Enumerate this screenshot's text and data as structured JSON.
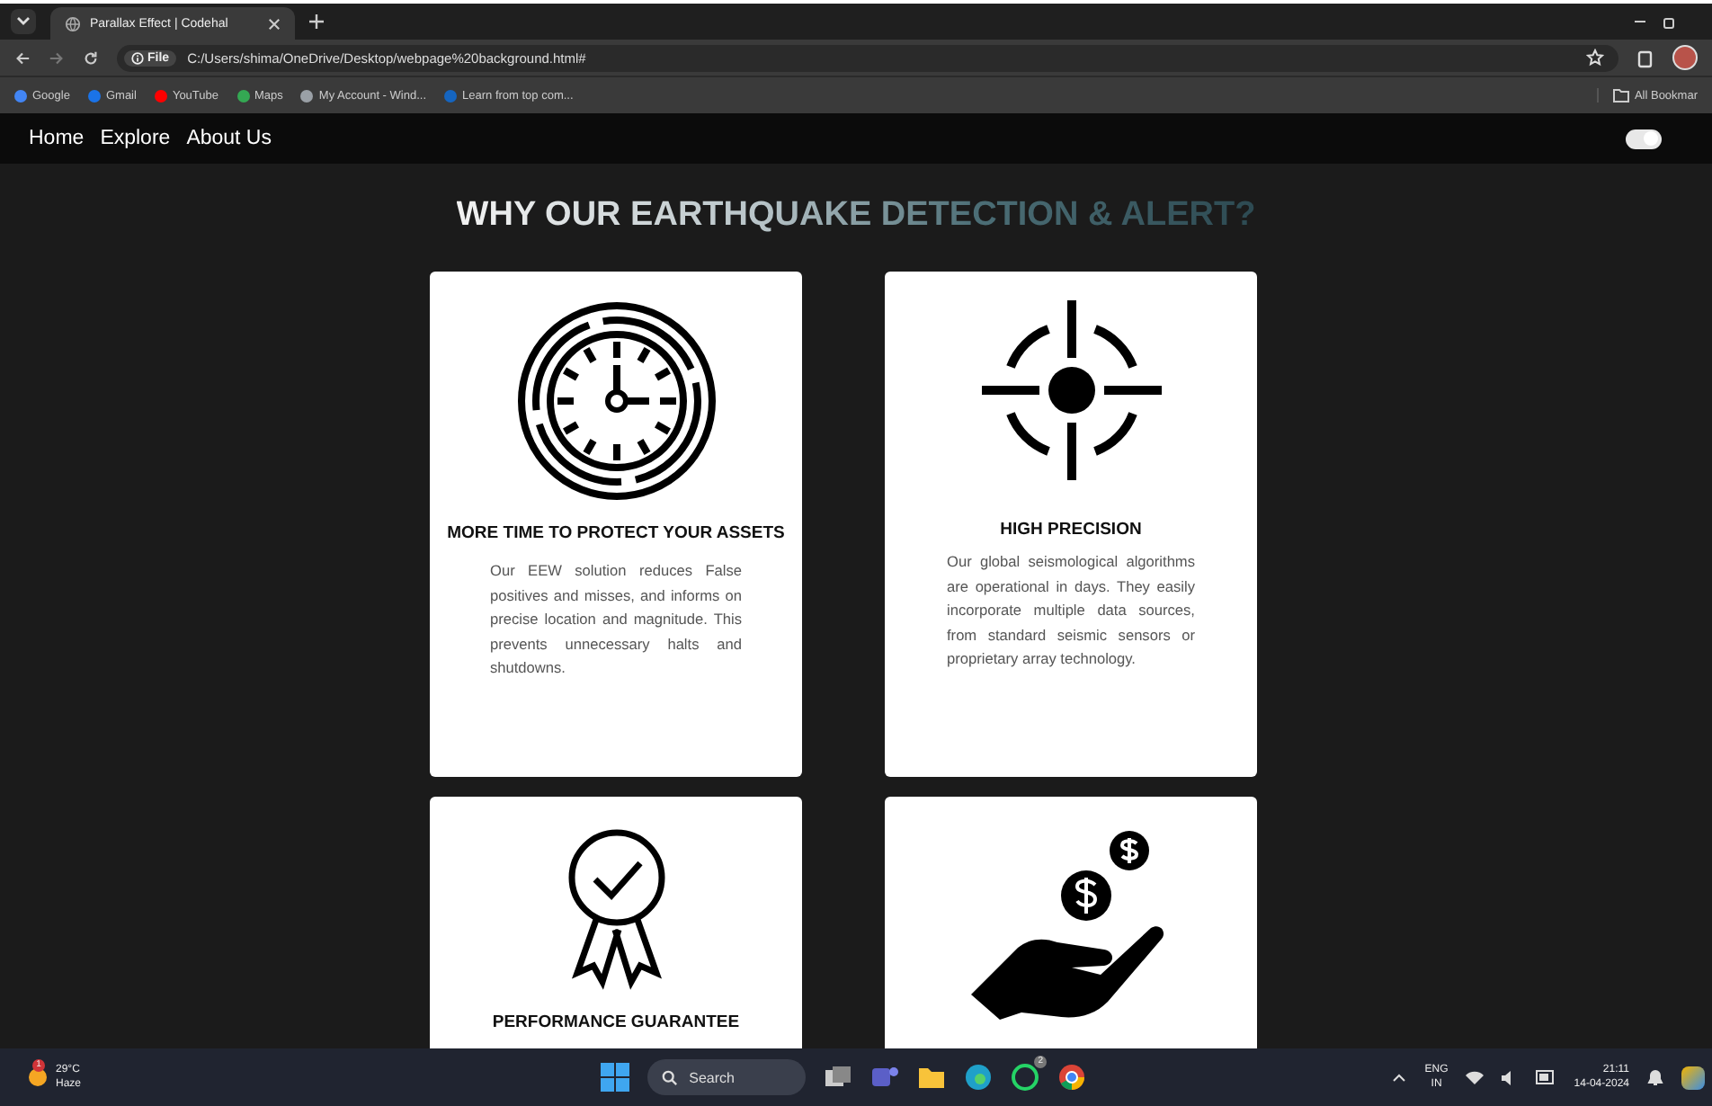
{
  "browser": {
    "tabs": [
      {
        "title": "Parallax Effect | Codehal",
        "selected": true
      }
    ],
    "address": {
      "chip": "File",
      "url": "C:/Users/shima/OneDrive/Desktop/webpage%20background.html#"
    },
    "bookmarks": [
      {
        "label": "Google",
        "color": "#4285f4"
      },
      {
        "label": "Gmail",
        "color": "#1a73e8"
      },
      {
        "label": "YouTube",
        "color": "#ff0000"
      },
      {
        "label": "Maps",
        "color": "#34a853"
      },
      {
        "label": "My Account - Wind...",
        "color": "#9aa0a6"
      },
      {
        "label": "Learn from top com...",
        "color": "#1565c0"
      }
    ],
    "all_bookmarks": "All Bookmar"
  },
  "nav": {
    "links": [
      "Home",
      "Explore",
      "About Us"
    ],
    "toggle": {
      "on": true
    }
  },
  "heading": "WHY OUR EARTHQUAKE DETECTION & ALERT?",
  "cards": [
    {
      "kind": "clock",
      "title": "MORE TIME TO PROTECT YOUR ASSETS",
      "text": "Our EEW solution reduces False positives and misses, and informs on precise location and magnitude. This prevents unnecessary halts and shutdowns."
    },
    {
      "kind": "target",
      "title": "HIGH PRECISION",
      "text": "Our global seismological algorithms are operational in days. They easily incorporate multiple data sources, from standard seismic sensors or proprietary array technology."
    },
    {
      "kind": "award",
      "title": "PERFORMANCE GUARANTEE"
    },
    {
      "kind": "money"
    }
  ],
  "taskbar": {
    "weather": {
      "temp": "29°C",
      "cond": "Haze",
      "badge": "1"
    },
    "search": "Search",
    "whatsapp_badge": "2",
    "lang": "ENG",
    "region": "IN",
    "time": "21:11",
    "date": "14-04-2024"
  }
}
